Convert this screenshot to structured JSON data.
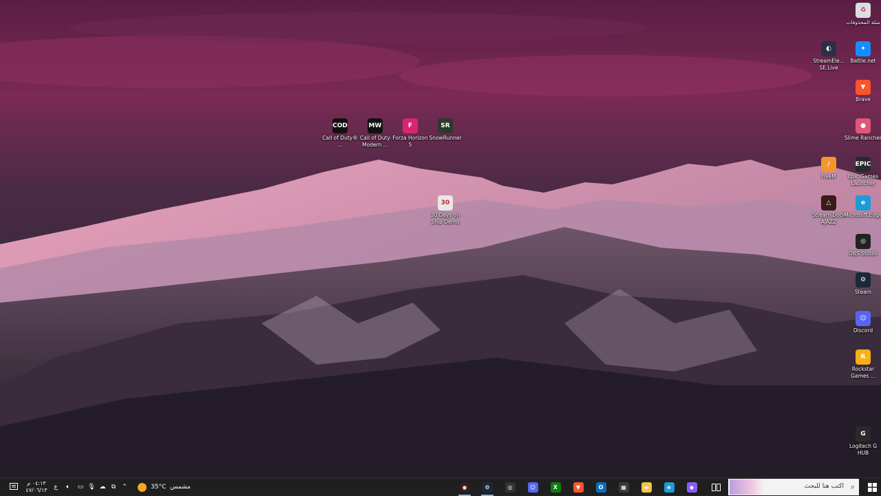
{
  "desktop": {
    "icons": [
      {
        "label": "سلة المحذوفات",
        "icon": "recycle-bin-icon",
        "color": "#d9dde2",
        "glyph": "♻"
      },
      {
        "label": "StreamEle... SE.Live",
        "icon": "streamelements-icon",
        "color": "#2a2f4a",
        "glyph": "◐"
      },
      {
        "label": "Battle.net",
        "icon": "battlenet-icon",
        "color": "#148eff",
        "glyph": "✦"
      },
      {
        "label": "Brave",
        "icon": "brave-icon",
        "color": "#fb542b",
        "glyph": "▼"
      },
      {
        "label": "Slime Rancher",
        "icon": "slime-rancher-icon",
        "color": "#e0577a",
        "glyph": "●"
      },
      {
        "label": "FiveM",
        "icon": "fivem-icon",
        "color": "#f49530",
        "glyph": "/"
      },
      {
        "label": "Epic Games Launcher",
        "icon": "epic-games-icon",
        "color": "#2a2a2a",
        "glyph": "EPIC"
      },
      {
        "label": "Stream Dock AJAZZ",
        "icon": "stream-dock-icon",
        "color": "#3a1a1a",
        "glyph": "△"
      },
      {
        "label": "Microsoft Edge",
        "icon": "edge-icon",
        "color": "#1c9bd7",
        "glyph": "e"
      },
      {
        "label": "OBS Studio",
        "icon": "obs-icon",
        "color": "#222222",
        "glyph": "◎"
      },
      {
        "label": "Steam",
        "icon": "steam-icon",
        "color": "#1b2838",
        "glyph": "⚙"
      },
      {
        "label": "Discord",
        "icon": "discord-icon",
        "color": "#5865f2",
        "glyph": "☺"
      },
      {
        "label": "Rockstar Games ...",
        "icon": "rockstar-icon",
        "color": "#fcaf17",
        "glyph": "R"
      },
      {
        "label": "Logitech G HUB",
        "icon": "logitech-ghub-icon",
        "color": "#2a2a2a",
        "glyph": "G"
      },
      {
        "label": "Call of Duty® ...",
        "icon": "call-of-duty-icon",
        "color": "#111111",
        "glyph": "COD"
      },
      {
        "label": "Call of Duty Modern ...",
        "icon": "call-of-duty-modern-warfare-icon",
        "color": "#111111",
        "glyph": "MW"
      },
      {
        "label": "Forza Horizon 5",
        "icon": "forza-horizon-icon",
        "color": "#d9246e",
        "glyph": "F"
      },
      {
        "label": "SnowRunner",
        "icon": "snowrunner-icon",
        "color": "#2e3a2a",
        "glyph": "SR"
      },
      {
        "label": "30 Days on Ship Demo",
        "icon": "30-days-on-ship-icon",
        "color": "#e8e8e8",
        "glyph": "30"
      }
    ]
  },
  "taskbar": {
    "start_icon": "windows-start-icon",
    "search_placeholder": "اكتب هنا للبحث",
    "taskview_icon": "task-view-icon",
    "apps": [
      {
        "name": "copilot",
        "icon": "copilot-icon",
        "color": "#8a5cf6",
        "glyph": "◆",
        "running": false
      },
      {
        "name": "edge",
        "icon": "edge-icon",
        "color": "#1c9bd7",
        "glyph": "e",
        "running": false
      },
      {
        "name": "file-explorer",
        "icon": "file-explorer-icon",
        "color": "#f4c542",
        "glyph": "▬",
        "running": false
      },
      {
        "name": "store",
        "icon": "microsoft-store-icon",
        "color": "#3a3a3a",
        "glyph": "▦",
        "running": false
      },
      {
        "name": "outlook",
        "icon": "outlook-icon",
        "color": "#0f6cbd",
        "glyph": "O",
        "running": false
      },
      {
        "name": "brave",
        "icon": "brave-icon",
        "color": "#fb542b",
        "glyph": "▼",
        "running": false
      },
      {
        "name": "xbox",
        "icon": "xbox-icon",
        "color": "#107c10",
        "glyph": "X",
        "running": false
      },
      {
        "name": "discord",
        "icon": "discord-icon",
        "color": "#5865f2",
        "glyph": "☺",
        "running": false
      },
      {
        "name": "obs",
        "icon": "obs-icon",
        "color": "#333333",
        "glyph": "◎",
        "running": false
      },
      {
        "name": "steam",
        "icon": "steam-icon",
        "color": "#1b2838",
        "glyph": "⚙",
        "running": true
      },
      {
        "name": "stream-dock",
        "icon": "stream-dock-icon",
        "color": "#3a1a1a",
        "glyph": "◉",
        "running": true
      }
    ],
    "weather": {
      "temp": "35°C",
      "condition": "مشمس",
      "icon": "sun-icon"
    },
    "tray": {
      "chevron_icon": "chevron-up-icon",
      "icons": [
        "network-icon",
        "speaker-icon",
        "onedrive-icon",
        "display-icon",
        "microphone-icon"
      ],
      "language": "ع",
      "time": "٠٤:١٣ م",
      "date": "٤٧/٠٦/١٣"
    },
    "notifications_icon": "notifications-icon"
  }
}
